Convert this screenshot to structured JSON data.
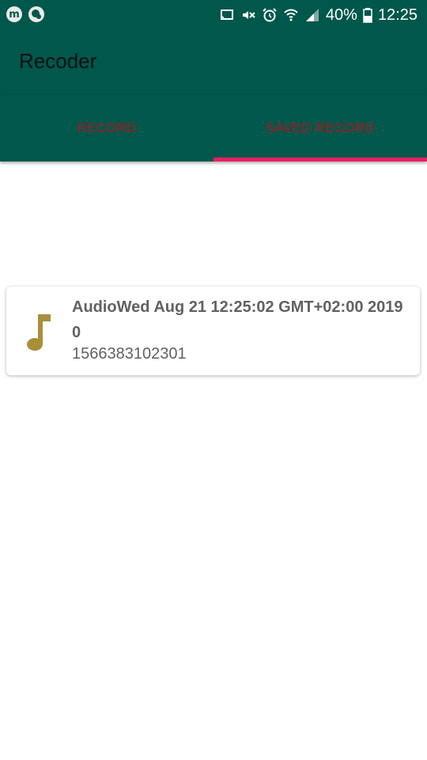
{
  "status_bar": {
    "left_icons": [
      "m-notification-icon",
      "chat-notification-icon"
    ],
    "right_icons": [
      "cast-icon",
      "mute-icon",
      "alarm-icon",
      "wifi-icon",
      "signal-icon",
      "battery-icon"
    ],
    "battery": "40%",
    "time": "12:25"
  },
  "app_bar": {
    "title": "Recoder"
  },
  "tabs": [
    {
      "label": "RECORD",
      "selected": false
    },
    {
      "label": "SAVED RECORD",
      "selected": true
    }
  ],
  "recordings": [
    {
      "icon": "music-note-icon",
      "title": "AudioWed Aug 21 12:25:02 GMT+02:00 2019 0",
      "subtitle": "1566383102301"
    }
  ],
  "colors": {
    "primary_dark": "#00574b",
    "tab_text": "#b0141a",
    "tab_indicator": "#e91e63",
    "icon": "#a8903a",
    "item_text": "#616161"
  }
}
